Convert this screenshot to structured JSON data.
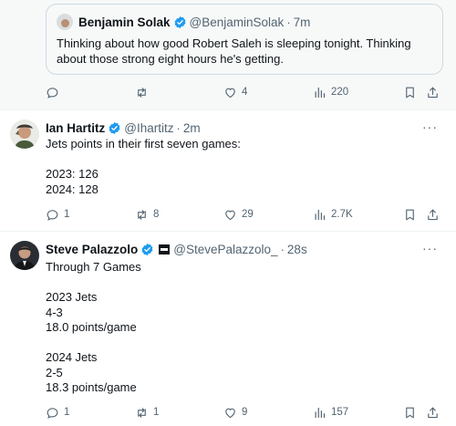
{
  "quote": {
    "author_name": "Benjamin Solak",
    "author_handle": "@BenjaminSolak",
    "separator": "·",
    "time": "7m",
    "text": "Thinking about how good Robert Saleh is sleeping tonight. Thinking about those strong eight hours he's getting."
  },
  "quote_actions": {
    "replies": "",
    "reposts": "",
    "likes": "4",
    "views": "220"
  },
  "tweets": [
    {
      "author_name": "Ian Hartitz",
      "author_handle": "@Ihartitz",
      "separator": "·",
      "time": "2m",
      "text": "Jets points in their first seven games:\n\n2023: 126\n2024: 128",
      "actions": {
        "replies": "1",
        "reposts": "8",
        "likes": "29",
        "views": "2.7K"
      }
    },
    {
      "author_name": "Steve Palazzolo",
      "author_handle": "@StevePalazzolo_",
      "separator": "·",
      "time": "28s",
      "text": "Through 7 Games\n\n2023 Jets\n4-3\n18.0 points/game\n\n2024 Jets\n2-5\n18.3 points/game",
      "actions": {
        "replies": "1",
        "reposts": "1",
        "likes": "9",
        "views": "157"
      }
    }
  ],
  "more_label": "···",
  "colors": {
    "accent": "#1d9bf0",
    "muted": "#536471",
    "text": "#0f1419",
    "border": "#cfd9de"
  },
  "icons": [
    "reply-icon",
    "repost-icon",
    "like-icon",
    "views-icon",
    "bookmark-icon",
    "share-icon",
    "verified-icon",
    "more-icon"
  ]
}
